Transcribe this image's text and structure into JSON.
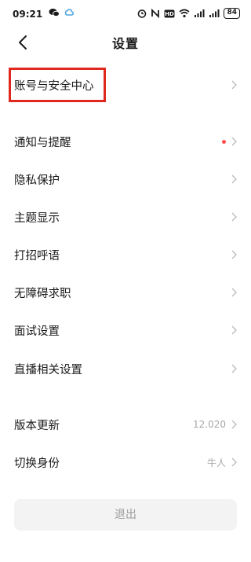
{
  "status_bar": {
    "time": "09:21",
    "battery": "84",
    "left_icons": [
      "wechat-icon",
      "cloud-icon"
    ],
    "right_icons": [
      "alarm-icon",
      "nfc-icon",
      "hd-icon",
      "wifi-icon",
      "signal-icon",
      "signal-icon"
    ]
  },
  "header": {
    "title": "设置"
  },
  "menu": {
    "items": [
      {
        "label": "账号与安全中心",
        "value": ""
      },
      {
        "label": "通知与提醒",
        "value": ""
      },
      {
        "label": "隐私保护",
        "value": ""
      },
      {
        "label": "主题显示",
        "value": ""
      },
      {
        "label": "打招呼语",
        "value": ""
      },
      {
        "label": "无障碍求职",
        "value": ""
      },
      {
        "label": "面试设置",
        "value": ""
      },
      {
        "label": "直播相关设置",
        "value": ""
      },
      {
        "label": "版本更新",
        "value": "12.020"
      },
      {
        "label": "切换身份",
        "value": "牛人"
      }
    ]
  },
  "footer": {
    "logout_label": "退出"
  },
  "colors": {
    "accent_red": "#e0291e",
    "notification_dot": "#ff4d4d",
    "muted_text": "#a8a8a8"
  }
}
